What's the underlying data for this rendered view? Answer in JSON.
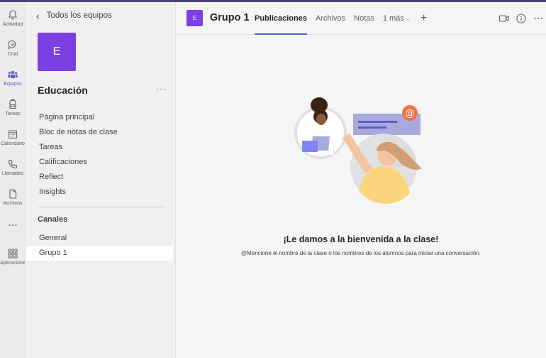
{
  "rail": {
    "items": [
      {
        "label": "Actividad",
        "icon": "bell-icon"
      },
      {
        "label": "Chat",
        "icon": "chat-icon"
      },
      {
        "label": "Equipos",
        "icon": "teams-icon",
        "active": true
      },
      {
        "label": "Tareas",
        "icon": "backpack-icon"
      },
      {
        "label": "Calendario",
        "icon": "calendar-icon"
      },
      {
        "label": "Llamadas",
        "icon": "phone-icon"
      },
      {
        "label": "Archivos",
        "icon": "file-icon"
      },
      {
        "label": "...",
        "icon": "more-icon"
      },
      {
        "label": "Aplicaciones",
        "icon": "apps-icon"
      }
    ]
  },
  "panel": {
    "back_label": "Todos los equipos",
    "team_avatar_letter": "E",
    "team_name": "Educación",
    "more_label": "···",
    "nav_items": [
      "Página principal",
      "Bloc de notas de clase",
      "Tareas",
      "Calificaciones",
      "Reflect",
      "Insights"
    ],
    "channels_title": "Canales",
    "channels": [
      "General",
      "Grupo 1"
    ],
    "selected_channel": "Grupo 1"
  },
  "header": {
    "channel_avatar_letter": "E",
    "channel_name": "Grupo 1",
    "tabs": [
      "Publicaciones",
      "Archivos",
      "Notas",
      "1 más"
    ],
    "active_tab": "Publicaciones",
    "add_tab_label": "+"
  },
  "content": {
    "welcome_title": "¡Le damos a la bienvenida a la clase!",
    "welcome_subtitle": "@Mencione el nombre de la clase o los nombres de los alumnos para iniciar una conversación."
  },
  "colors": {
    "accent": "#5b5fc7",
    "team_avatar": "#7b3fe4",
    "top_strip": "#464775"
  }
}
